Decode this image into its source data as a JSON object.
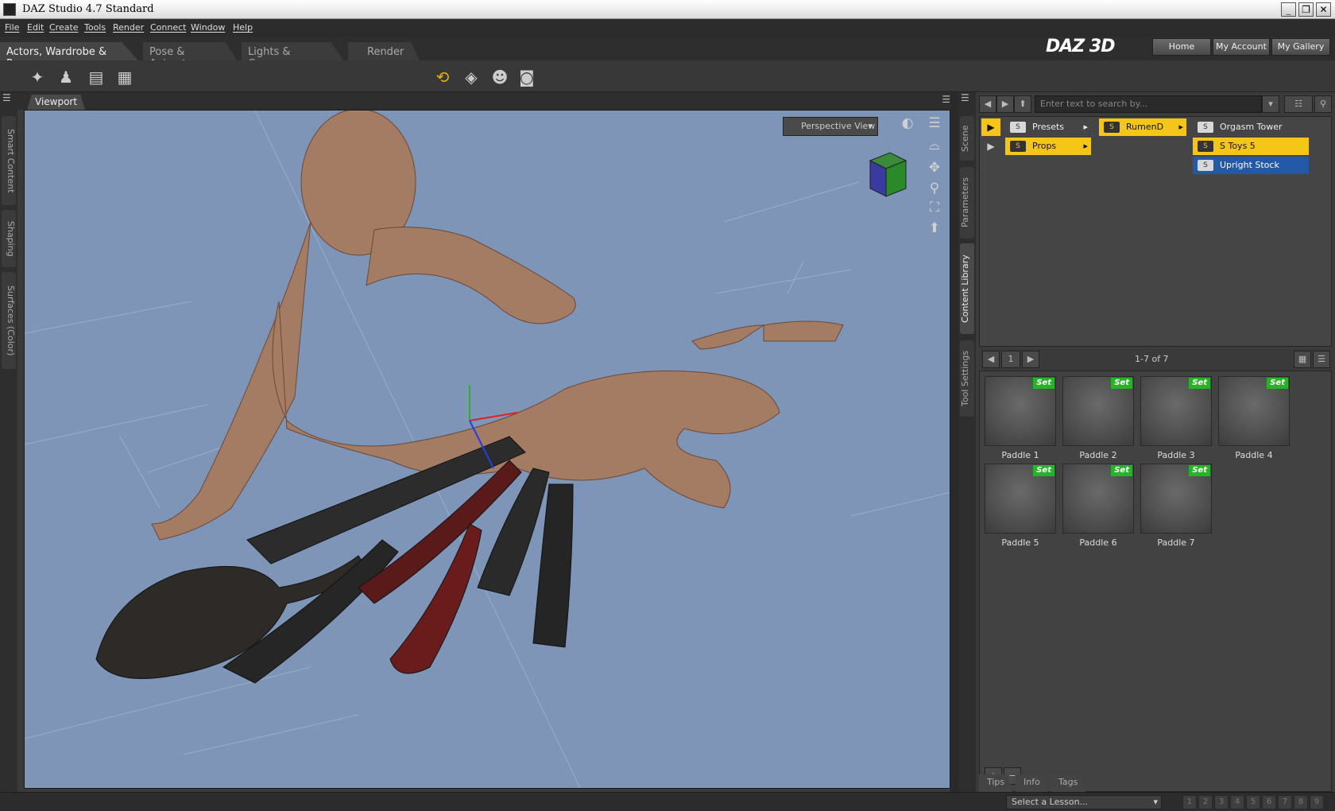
{
  "window": {
    "title": "DAZ Studio 4.7 Standard"
  },
  "menu": [
    "File",
    "Edit",
    "Create",
    "Tools",
    "Render",
    "Connect",
    "Window",
    "Help"
  ],
  "rooms": [
    "Actors, Wardrobe & Props",
    "Pose & Animate",
    "Lights & Cameras",
    "Render"
  ],
  "header_buttons": [
    "Home",
    "My Account",
    "My Gallery"
  ],
  "logo": "DAZ 3D",
  "left_tabs": [
    "Smart Content",
    "Shaping",
    "Surfaces (Color)"
  ],
  "right_tabs": [
    "Scene",
    "Parameters",
    "Content Library",
    "Tool Settings"
  ],
  "viewport": {
    "tab": "Viewport",
    "view_select": "Perspective View"
  },
  "content": {
    "search_placeholder": "Enter text to search by...",
    "col1": [
      "Presets",
      "Props"
    ],
    "col2": [
      "RumenD"
    ],
    "col3": [
      "Orgasm Tower",
      "S Toys 5",
      "Upright Stock"
    ],
    "page": "1",
    "count": "1-7 of 7",
    "set_badge": "Set",
    "items": [
      "Paddle 1",
      "Paddle 2",
      "Paddle 3",
      "Paddle 4",
      "Paddle 5",
      "Paddle 6",
      "Paddle 7"
    ]
  },
  "bottom_tabs": [
    "Tips",
    "Info",
    "Tags"
  ],
  "lesson": {
    "select": "Select a Lesson...",
    "pages": [
      "1",
      "2",
      "3",
      "4",
      "5",
      "6",
      "7",
      "8",
      "9"
    ]
  },
  "colors": {
    "accent": "#f5c518",
    "selected_blue": "#2458a8",
    "set_badge": "#27b327",
    "viewport_bg": "#7e95b8"
  }
}
